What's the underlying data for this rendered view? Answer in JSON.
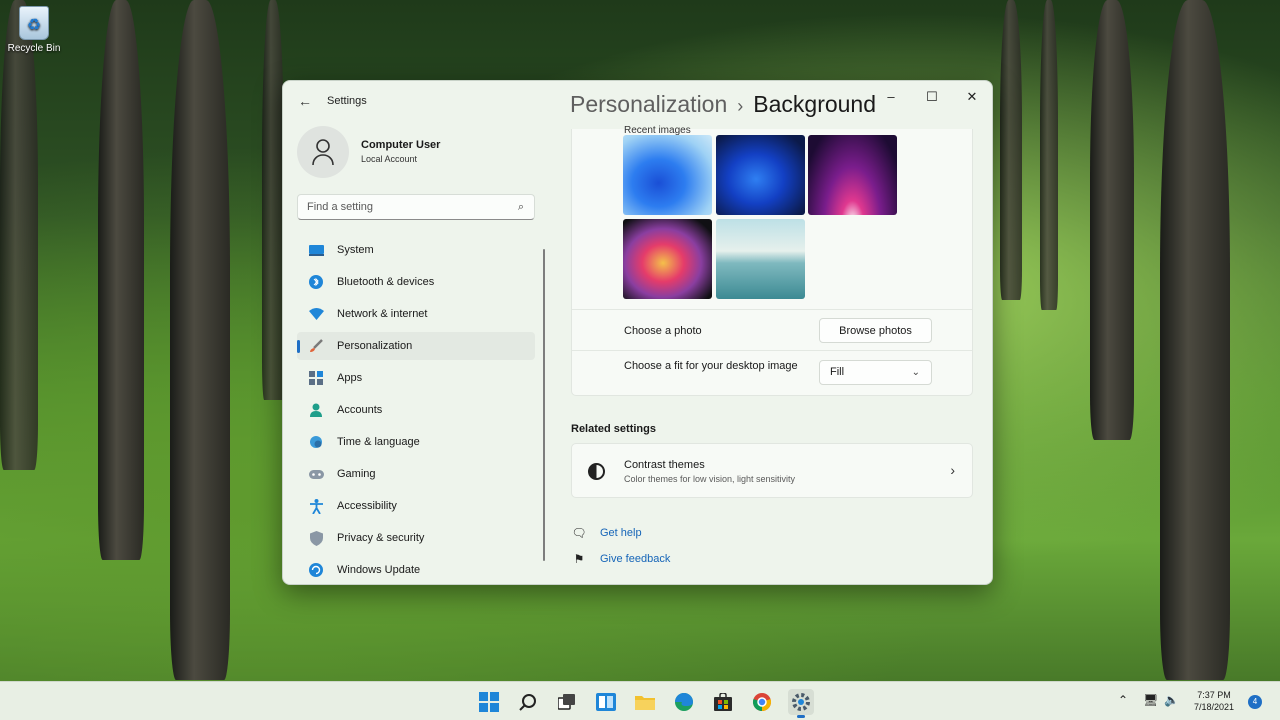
{
  "desktop": {
    "recycle_bin_label": "Recycle Bin"
  },
  "window": {
    "app_title": "Settings",
    "breadcrumb_parent": "Personalization",
    "breadcrumb_separator": "›",
    "page_title": "Background",
    "controls": {
      "minimize": "–",
      "maximize": "☐",
      "close": "✕"
    }
  },
  "profile": {
    "name": "Computer User",
    "account_type": "Local Account"
  },
  "search": {
    "placeholder": "Find a setting"
  },
  "sidebar": {
    "items": [
      {
        "label": "System",
        "icon": "display-icon",
        "active": false
      },
      {
        "label": "Bluetooth & devices",
        "icon": "bluetooth-icon",
        "active": false
      },
      {
        "label": "Network & internet",
        "icon": "wifi-icon",
        "active": false
      },
      {
        "label": "Personalization",
        "icon": "brush-icon",
        "active": true
      },
      {
        "label": "Apps",
        "icon": "apps-icon",
        "active": false
      },
      {
        "label": "Accounts",
        "icon": "person-icon",
        "active": false
      },
      {
        "label": "Time & language",
        "icon": "globe-clock-icon",
        "active": false
      },
      {
        "label": "Gaming",
        "icon": "gamepad-icon",
        "active": false
      },
      {
        "label": "Accessibility",
        "icon": "accessibility-icon",
        "active": false
      },
      {
        "label": "Privacy & security",
        "icon": "shield-icon",
        "active": false
      },
      {
        "label": "Windows Update",
        "icon": "update-icon",
        "active": false
      }
    ]
  },
  "background": {
    "recent_images_label": "Recent images",
    "choose_photo_label": "Choose a photo",
    "browse_button": "Browse photos",
    "fit_label": "Choose a fit for your desktop image",
    "fit_value": "Fill"
  },
  "related": {
    "title": "Related settings",
    "contrast_title": "Contrast themes",
    "contrast_subtitle": "Color themes for low vision, light sensitivity"
  },
  "help": {
    "get_help": "Get help",
    "give_feedback": "Give feedback"
  },
  "taskbar": {
    "time": "7:37 PM",
    "date": "7/18/2021",
    "notification_count": "4"
  },
  "colors": {
    "accent": "#1f6fc5",
    "link": "#1665b8"
  }
}
